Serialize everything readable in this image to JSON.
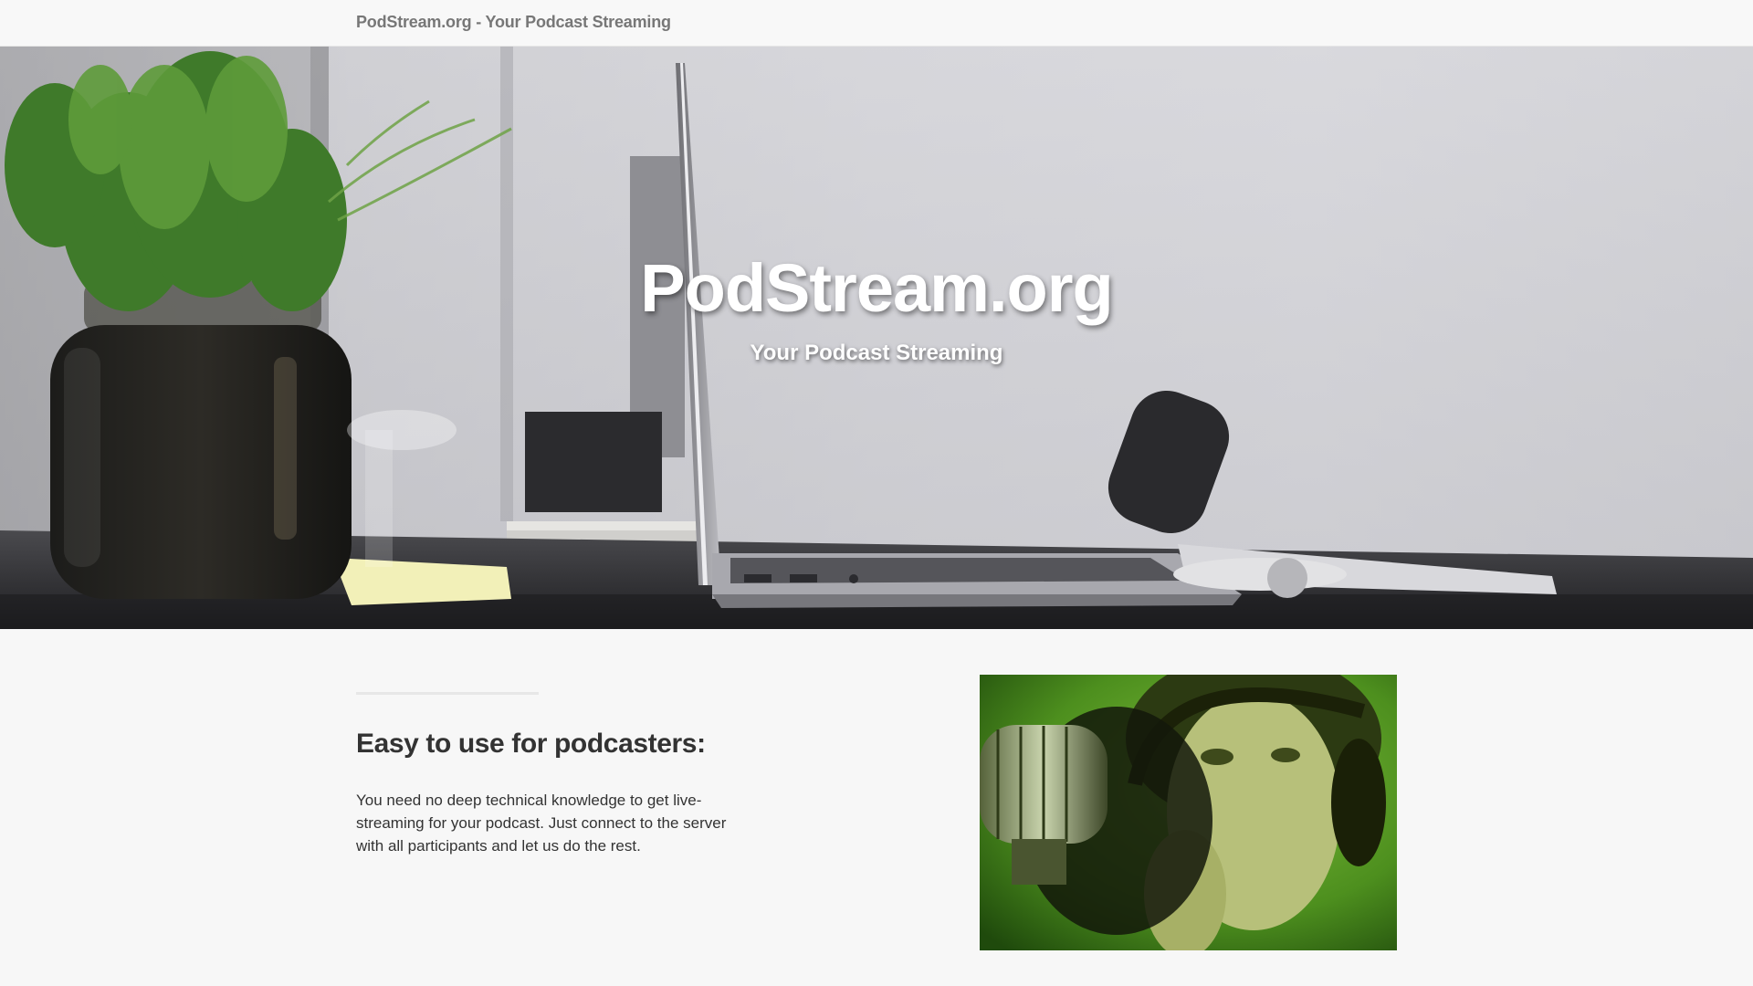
{
  "navbar": {
    "brand": "PodStream.org - Your Podcast Streaming"
  },
  "hero": {
    "title": "PodStream.org",
    "subtitle": "Your Podcast Streaming"
  },
  "feature": {
    "heading": "Easy to use for podcasters:",
    "text": "You need no deep technical knowledge to get live-streaming for your podcast. Just connect to the server with all participants and let us do the rest."
  },
  "colors": {
    "navbar_bg": "#f8f8f8",
    "page_bg": "#f7f7f7",
    "brand_text": "#777777",
    "hero_text": "#ffffff",
    "body_text": "#333333",
    "image_tint": "#5aa020"
  }
}
